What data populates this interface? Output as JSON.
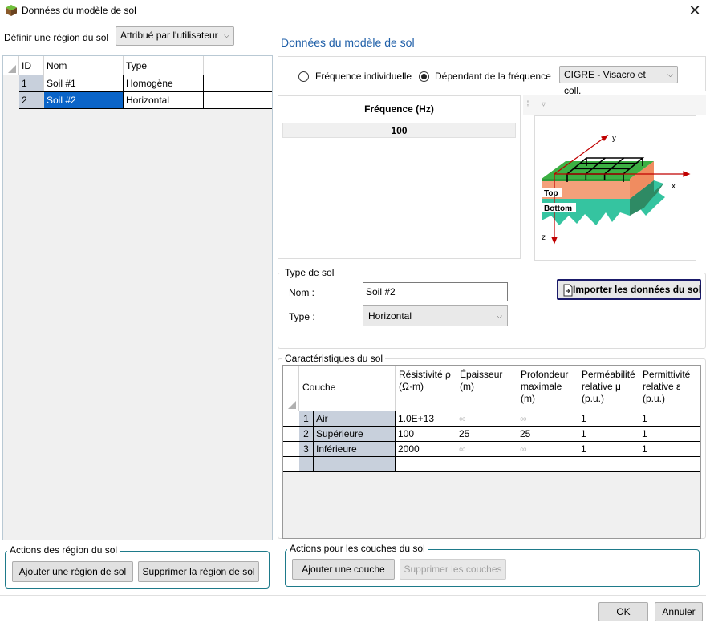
{
  "window": {
    "title": "Données du modèle de sol",
    "close_glyph": "✕"
  },
  "left": {
    "region_label": "Définir une région du sol",
    "region_mode": "Attribué par l'utilisateur",
    "grid": {
      "headers": [
        "ID",
        "Nom",
        "Type"
      ],
      "rows": [
        {
          "id": "1",
          "name": "Soil #1",
          "type": "Homogène"
        },
        {
          "id": "2",
          "name": "Soil #2",
          "type": "Horizontal"
        }
      ]
    },
    "actions_title": "Actions des région du sol",
    "add_region": "Ajouter une région de sol",
    "delete_region": "Supprimer la région de sol"
  },
  "right": {
    "heading": "Données du modèle de sol",
    "freq_individual": "Fréquence individuelle",
    "freq_dependent": "Dépendant de la fréquence",
    "freq_model": "CIGRE - Visacro et coll.",
    "freq_table_header": "Fréquence (Hz)",
    "freq_value": "100",
    "diagram": {
      "axis_x": "x",
      "axis_y": "y",
      "axis_z": "z",
      "top": "Top",
      "bottom": "Bottom",
      "colors": {
        "grass": "#3cb043",
        "top_soil": "#f4a07a",
        "bottom_soil": "#35c4a0",
        "axis": "#c00000"
      }
    },
    "soil_type": {
      "title": "Type de sol",
      "name_label": "Nom :",
      "name_value": "Soil #2",
      "type_label": "Type :",
      "type_value": "Horizontal",
      "import_button": "Importer les données du sol"
    },
    "characteristics": {
      "title": "Caractéristiques du sol",
      "headers": [
        "Couche",
        "Résistivité ρ (Ω·m)",
        "Épaisseur (m)",
        "Profondeur maximale (m)",
        "Perméabilité relative μ (p.u.)",
        "Permittivité relative ε (p.u.)"
      ],
      "rows": [
        {
          "idx": "1",
          "name": "Air",
          "rho": "1.0E+13",
          "thick": "∞",
          "depth": "∞",
          "mu": "1",
          "eps": "1"
        },
        {
          "idx": "2",
          "name": "Supérieure",
          "rho": "100",
          "thick": "25",
          "depth": "25",
          "mu": "1",
          "eps": "1"
        },
        {
          "idx": "3",
          "name": "Inférieure",
          "rho": "2000",
          "thick": "∞",
          "depth": "∞",
          "mu": "1",
          "eps": "1"
        }
      ]
    },
    "layer_actions_title": "Actions pour les couches du sol",
    "add_layer": "Ajouter une couche",
    "delete_layers": "Supprimer les couches"
  },
  "footer": {
    "ok": "OK",
    "cancel": "Annuler"
  }
}
